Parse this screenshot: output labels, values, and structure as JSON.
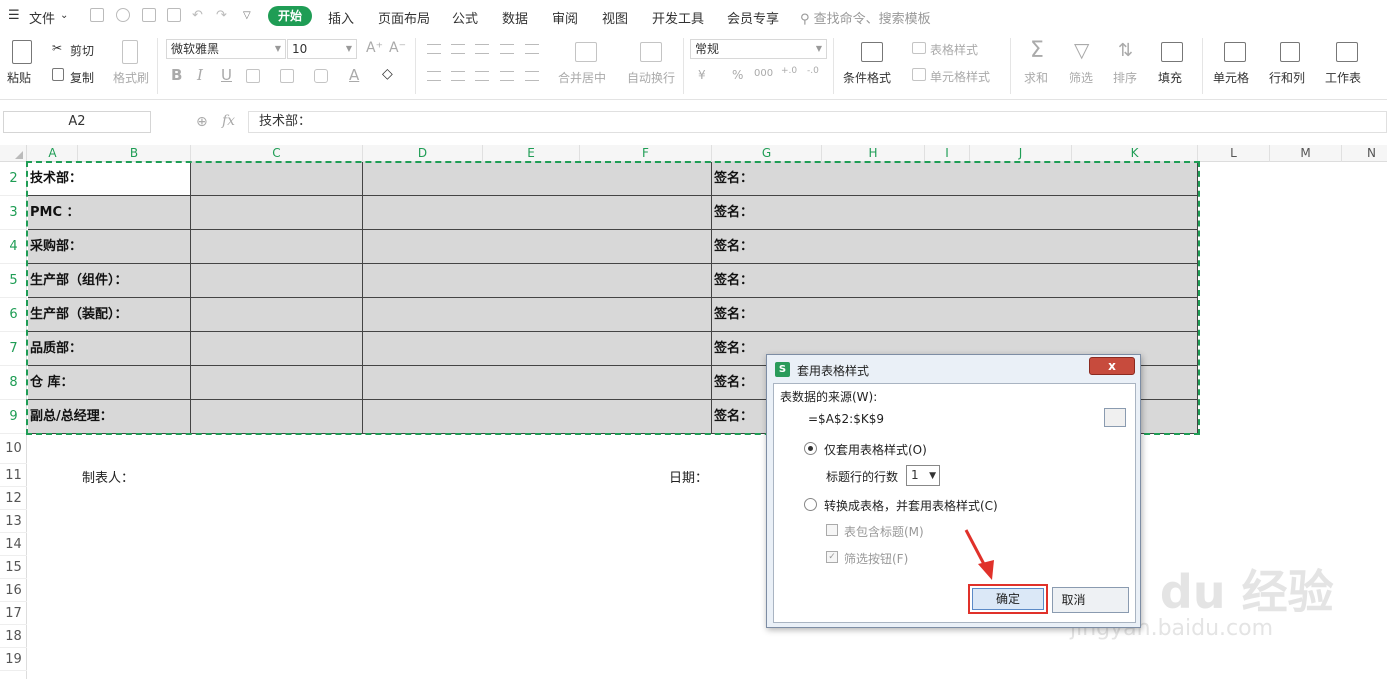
{
  "menubar": {
    "file": "文件",
    "tabs": [
      "开始",
      "插入",
      "页面布局",
      "公式",
      "数据",
      "审阅",
      "视图",
      "开发工具",
      "会员专享"
    ],
    "search_placeholder": "查找命令、搜索模板"
  },
  "ribbon": {
    "paste": "粘贴",
    "cut": "剪切",
    "copy": "复制",
    "format_painter": "格式刷",
    "font_name": "微软雅黑",
    "font_size": "10",
    "bold": "B",
    "italic": "I",
    "underline": "U",
    "merge_center": "合并居中",
    "wrap_text": "自动换行",
    "number_format": "常规",
    "percent": "%",
    "thousands": "000",
    "conditional_format": "条件格式",
    "table_style": "表格样式",
    "cell_style": "单元格样式",
    "sum": "求和",
    "filter": "筛选",
    "sort": "排序",
    "fill": "填充",
    "cell": "单元格",
    "row_col": "行和列",
    "worksheet": "工作表"
  },
  "formula_bar": {
    "name_box": "A2",
    "fx": "fx",
    "content": "技术部："
  },
  "sheet": {
    "columns": [
      "A",
      "B",
      "C",
      "D",
      "E",
      "F",
      "G",
      "H",
      "I",
      "J",
      "K",
      "L",
      "M",
      "N"
    ],
    "rows": [
      "2",
      "3",
      "4",
      "5",
      "6",
      "7",
      "8",
      "9",
      "10",
      "11",
      "12",
      "13",
      "14",
      "15",
      "16",
      "17",
      "18",
      "19"
    ],
    "table_rows": [
      {
        "dept": "技术部：",
        "sign": "签名："
      },
      {
        "dept": "PMC  ：",
        "sign": "签名："
      },
      {
        "dept": "采购部：",
        "sign": "签名："
      },
      {
        "dept": "生产部（组件）：",
        "sign": "签名："
      },
      {
        "dept": "生产部（装配）：",
        "sign": "签名："
      },
      {
        "dept": "品质部：",
        "sign": "签名："
      },
      {
        "dept": "仓  库：",
        "sign": "签名："
      },
      {
        "dept": "副总/总经理：",
        "sign": "签名："
      }
    ],
    "maker_label": "制表人：",
    "date_label": "日期："
  },
  "dialog": {
    "title": "套用表格样式",
    "logo": "S",
    "close": "x",
    "source_label": "表数据的来源(W):",
    "source_value": "=$A$2:$K$9",
    "option_style_only": "仅套用表格样式(O)",
    "header_rows_label": "标题行的行数",
    "header_rows_value": "1",
    "option_convert": "转换成表格，并套用表格样式(C)",
    "include_header": "表包含标题(M)",
    "filter_buttons": "筛选按钮(F)",
    "ok": "确定",
    "cancel": "取消"
  },
  "watermark": {
    "brand": "Bai du 经验",
    "url": "jingyan.baidu.com"
  },
  "colors": {
    "accent": "#1f9d55",
    "table_fill": "#d8d8d8",
    "highlight": "#e0312a"
  }
}
